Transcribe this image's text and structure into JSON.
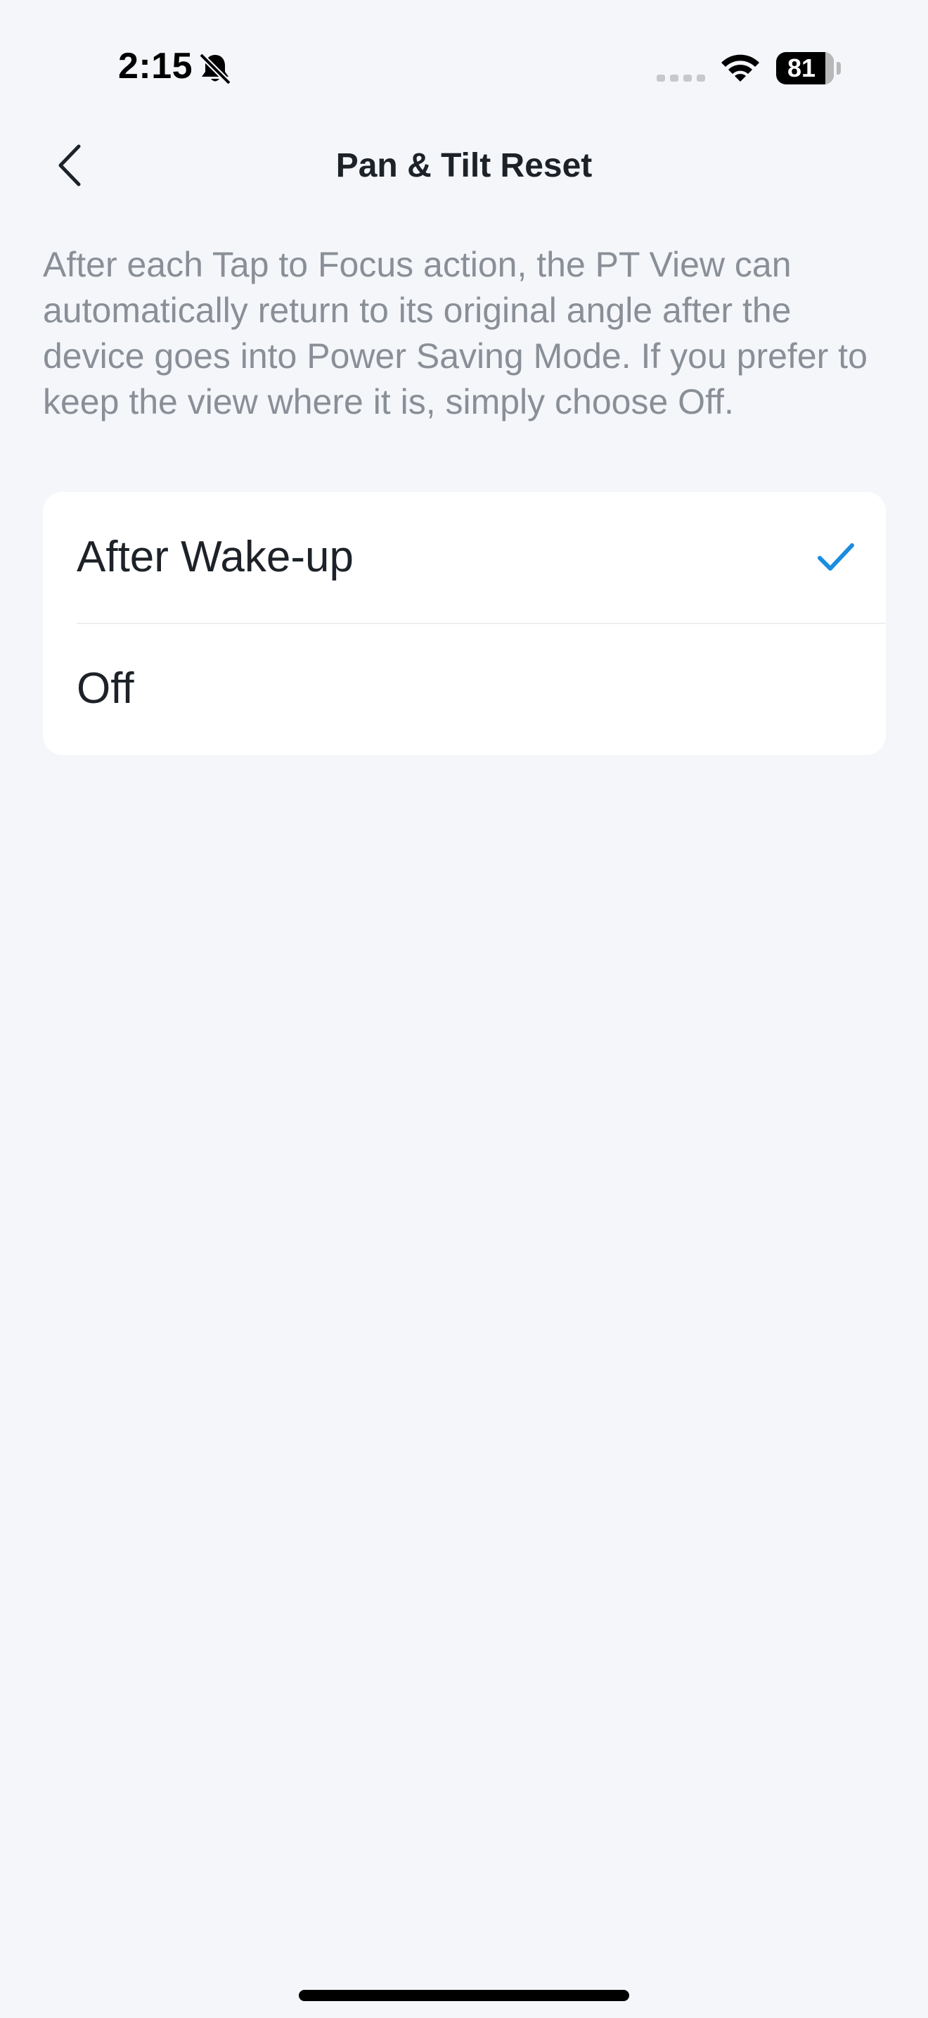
{
  "status_bar": {
    "time": "2:15",
    "battery": "81"
  },
  "header": {
    "title": "Pan & Tilt Reset"
  },
  "description": "After each Tap to Focus action, the PT View can automatically return to its original angle after the device goes into Power Saving Mode. If you prefer to keep the view where it is, simply choose Off.",
  "options": [
    {
      "label": "After Wake-up",
      "selected": true
    },
    {
      "label": "Off",
      "selected": false
    }
  ],
  "colors": {
    "background": "#f4f6fa",
    "accent": "#1a8de0",
    "description_text": "#8a8f97"
  },
  "icons": {
    "back": "chevron-left-icon",
    "check": "checkmark-icon",
    "bell": "bell-slash-icon",
    "wifi": "wifi-icon",
    "signal": "cellular-signal-icon"
  }
}
